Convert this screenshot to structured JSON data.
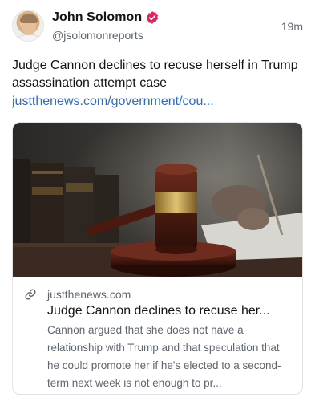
{
  "author": {
    "name": "John Solomon",
    "handle": "@jsolomonreports",
    "verified_icon": "verified-badge-icon",
    "verified_color": "#e0245e"
  },
  "post": {
    "timestamp": "19m",
    "text": "Judge Cannon declines to recuse herself in Trump assassination attempt case",
    "link_text": "justthenews.com/government/cou..."
  },
  "link_card": {
    "domain": "justthenews.com",
    "domain_icon": "link-icon",
    "title": "Judge Cannon declines to recuse her...",
    "description": "Cannon argued that she does not have a relationship with Trump and that speculation that he could promote her if he's elected to a second-term next week is not enough to pr...",
    "image_subject": "gavel-photo"
  },
  "colors": {
    "link": "#2e6bc8",
    "muted": "#5f6670",
    "text": "#141414",
    "border": "#dfe2e6"
  }
}
